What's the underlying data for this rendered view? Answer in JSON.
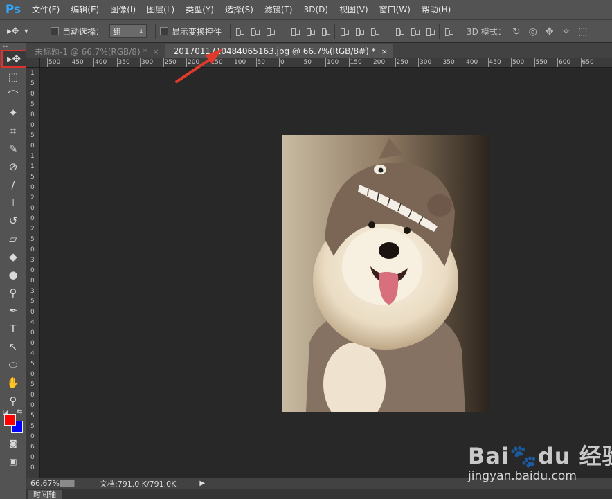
{
  "app": {
    "logo": "Ps",
    "accent": "#31a8ff"
  },
  "menu": [
    {
      "label": "文件(F)"
    },
    {
      "label": "编辑(E)"
    },
    {
      "label": "图像(I)"
    },
    {
      "label": "图层(L)"
    },
    {
      "label": "类型(Y)"
    },
    {
      "label": "选择(S)"
    },
    {
      "label": "滤镜(T)"
    },
    {
      "label": "3D(D)"
    },
    {
      "label": "视图(V)"
    },
    {
      "label": "窗口(W)"
    },
    {
      "label": "帮助(H)"
    }
  ],
  "options": {
    "tool_icon": "move-tool-icon",
    "auto_select_label": "自动选择：",
    "auto_select_checked": false,
    "auto_select_target": "组",
    "show_transform_label": "显示变换控件",
    "show_transform_checked": false,
    "mode_3d_label": "3D 模式："
  },
  "tabs": [
    {
      "label": "未标题-1 @ 66.7%(RGB/8) *",
      "close": "×",
      "active": false
    },
    {
      "label": "20170117104840651​63.jpg @ 66.7%(RGB/8#) *",
      "close": "×",
      "active": true
    }
  ],
  "ruler": {
    "top_labels": [
      "500",
      "450",
      "400",
      "350",
      "300",
      "250",
      "200",
      "150",
      "100",
      "50",
      "0",
      "50",
      "100",
      "150",
      "200",
      "250",
      "300",
      "350",
      "400",
      "450",
      "500",
      "550",
      "600",
      "650"
    ],
    "left_labels": [
      "1",
      "5",
      "0",
      "5",
      "0",
      "0",
      "5",
      "0",
      "1",
      "1",
      "5",
      "0",
      "2",
      "0",
      "0",
      "2",
      "5",
      "0",
      "3",
      "0",
      "0",
      "3",
      "5",
      "0",
      "4",
      "0",
      "0",
      "4",
      "5",
      "0",
      "5",
      "0",
      "0",
      "5",
      "5",
      "0",
      "6",
      "0",
      "0"
    ]
  },
  "tools": [
    {
      "name": "move-tool",
      "glyph": "▸✥",
      "active": true
    },
    {
      "name": "marquee-tool",
      "glyph": "⬚"
    },
    {
      "name": "lasso-tool",
      "glyph": "⌒"
    },
    {
      "name": "magic-wand-tool",
      "glyph": "✦"
    },
    {
      "name": "crop-tool",
      "glyph": "⌗"
    },
    {
      "name": "eyedropper-tool",
      "glyph": "✎"
    },
    {
      "name": "healing-brush-tool",
      "glyph": "⊘"
    },
    {
      "name": "brush-tool",
      "glyph": "∕"
    },
    {
      "name": "clone-stamp-tool",
      "glyph": "⊥"
    },
    {
      "name": "history-brush-tool",
      "glyph": "↺"
    },
    {
      "name": "eraser-tool",
      "glyph": "▱"
    },
    {
      "name": "paint-bucket-tool",
      "glyph": "◆"
    },
    {
      "name": "blur-tool",
      "glyph": "●"
    },
    {
      "name": "dodge-tool",
      "glyph": "⚲"
    },
    {
      "name": "pen-tool",
      "glyph": "✒"
    },
    {
      "name": "type-tool",
      "glyph": "T"
    },
    {
      "name": "path-selection-tool",
      "glyph": "↖"
    },
    {
      "name": "ellipse-tool",
      "glyph": "⬭"
    },
    {
      "name": "hand-tool",
      "glyph": "✋"
    },
    {
      "name": "zoom-tool",
      "glyph": "⚲"
    }
  ],
  "colors": {
    "foreground": "#ff0000",
    "background": "#0000ff"
  },
  "status": {
    "zoom": "66.67%",
    "doc_info": "文档:791.0 K/791.0K",
    "more_icon": "▶"
  },
  "timeline": {
    "tab_label": "时间轴"
  },
  "annotation": {
    "highlight_color": "#e0312f"
  },
  "watermark": {
    "brand": "Bai🐾du 经验",
    "url": "jingyan.baidu.com"
  }
}
